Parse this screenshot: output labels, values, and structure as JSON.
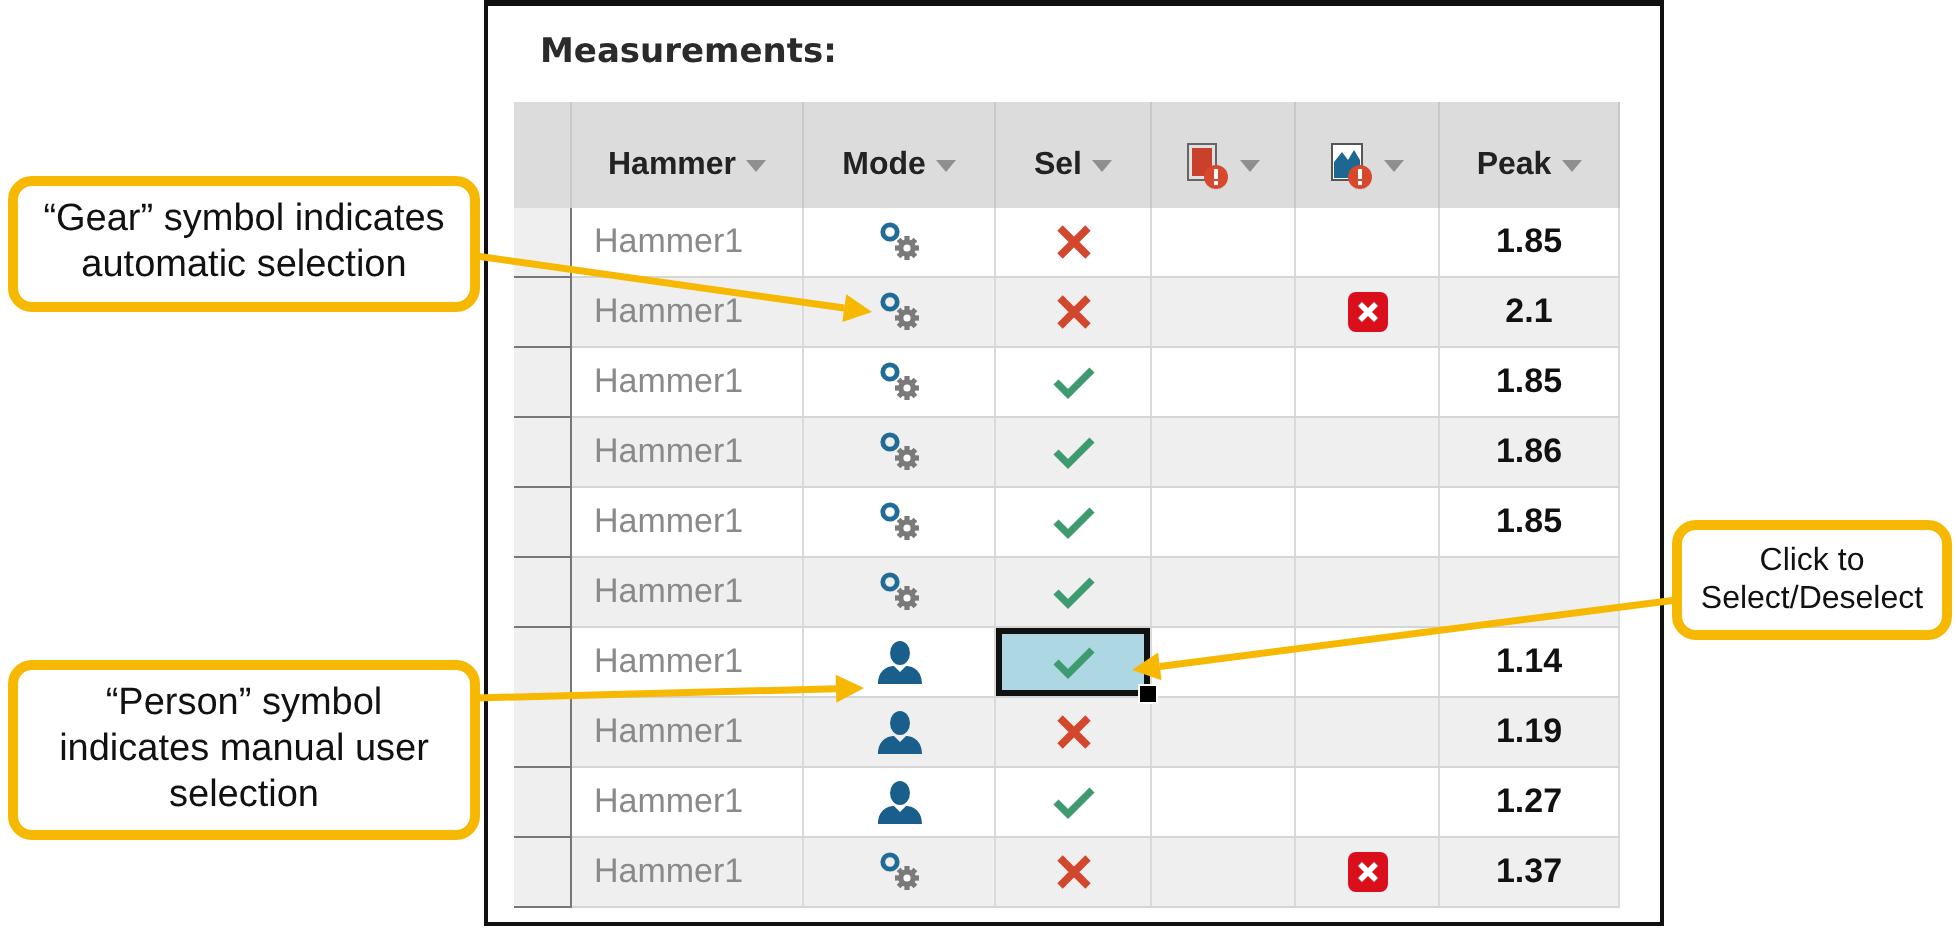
{
  "panel": {
    "title": "Measurements:"
  },
  "table": {
    "columns": [
      {
        "kind": "text",
        "label": "Hammer"
      },
      {
        "kind": "text",
        "label": "Mode"
      },
      {
        "kind": "text",
        "label": "Sel"
      },
      {
        "kind": "icon"
      },
      {
        "kind": "icon"
      },
      {
        "kind": "text",
        "label": "Peak"
      }
    ],
    "rows": [
      {
        "hammer": "Hammer1",
        "kind": "auto",
        "included": false,
        "focused": false,
        "flagged": false,
        "peak": "1.85"
      },
      {
        "hammer": "Hammer1",
        "kind": "auto",
        "included": false,
        "focused": false,
        "flagged": true,
        "peak": "2.1"
      },
      {
        "hammer": "Hammer1",
        "kind": "auto",
        "included": true,
        "focused": false,
        "flagged": false,
        "peak": "1.85"
      },
      {
        "hammer": "Hammer1",
        "kind": "auto",
        "included": true,
        "focused": false,
        "flagged": false,
        "peak": "1.86"
      },
      {
        "hammer": "Hammer1",
        "kind": "auto",
        "included": true,
        "focused": false,
        "flagged": false,
        "peak": "1.85"
      },
      {
        "hammer": "Hammer1",
        "kind": "auto",
        "included": true,
        "focused": false,
        "flagged": false
      },
      {
        "hammer": "Hammer1",
        "kind": "manual",
        "included": true,
        "focused": true,
        "flagged": false,
        "peak": "1.14"
      },
      {
        "hammer": "Hammer1",
        "kind": "manual",
        "included": false,
        "focused": false,
        "flagged": false,
        "peak": "1.19"
      },
      {
        "hammer": "Hammer1",
        "kind": "manual",
        "included": true,
        "focused": false,
        "flagged": false,
        "peak": "1.27"
      },
      {
        "hammer": "Hammer1",
        "kind": "auto",
        "included": false,
        "focused": false,
        "flagged": true,
        "peak": "1.37"
      }
    ]
  },
  "callouts": [
    {
      "text": "“Gear” symbol indicates automatic selection"
    },
    {
      "text": "Click to Select/Deselect"
    },
    {
      "text": "“Person” symbol indicates manual user selection"
    }
  ]
}
